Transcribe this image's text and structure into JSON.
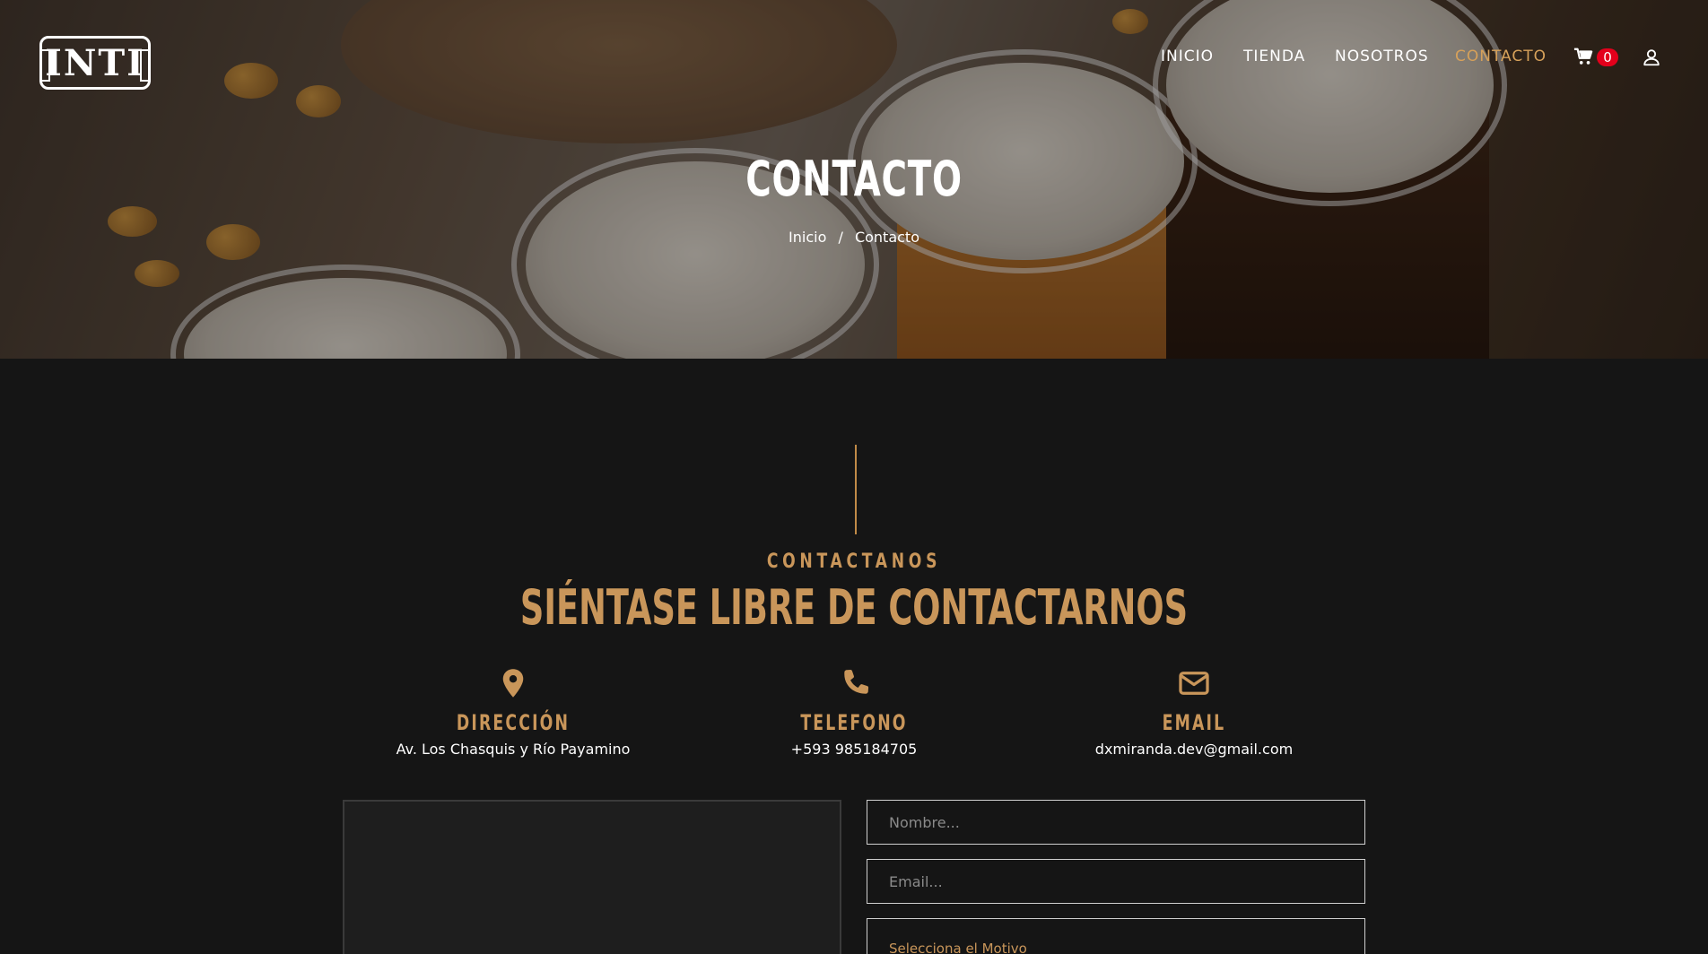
{
  "brand": {
    "logo_text": "INTI"
  },
  "nav": {
    "items": [
      {
        "label": "INICIO"
      },
      {
        "label": "TIENDA"
      },
      {
        "label": "NOSOTROS"
      },
      {
        "label": "CONTACTO"
      }
    ],
    "active": "CONTACTO",
    "cart_count": "0"
  },
  "hero": {
    "title": "CONTACTO",
    "breadcrumb": {
      "home": "Inicio",
      "separator": "/",
      "current": "Contacto"
    }
  },
  "section": {
    "eyebrow": "CONTACTANOS",
    "headline": "SIÉNTASE LIBRE DE CONTACTARNOS"
  },
  "info": {
    "address": {
      "label": "DIRECCIÓN",
      "value": "Av. Los Chasquis y Río Payamino",
      "icon": "map-pin-icon"
    },
    "phone": {
      "label": "TELEFONO",
      "value": "+593 985184705",
      "icon": "phone-icon"
    },
    "email": {
      "label": "EMAIL",
      "value": "dxmiranda.dev@gmail.com",
      "icon": "envelope-icon"
    }
  },
  "form": {
    "name_placeholder": "Nombre...",
    "email_placeholder": "Email...",
    "reason_placeholder": "Selecciona el Motivo"
  },
  "colors": {
    "accent": "#c9965a",
    "active_nav": "#d6a15a",
    "badge": "#e3001b",
    "background": "#151515"
  }
}
